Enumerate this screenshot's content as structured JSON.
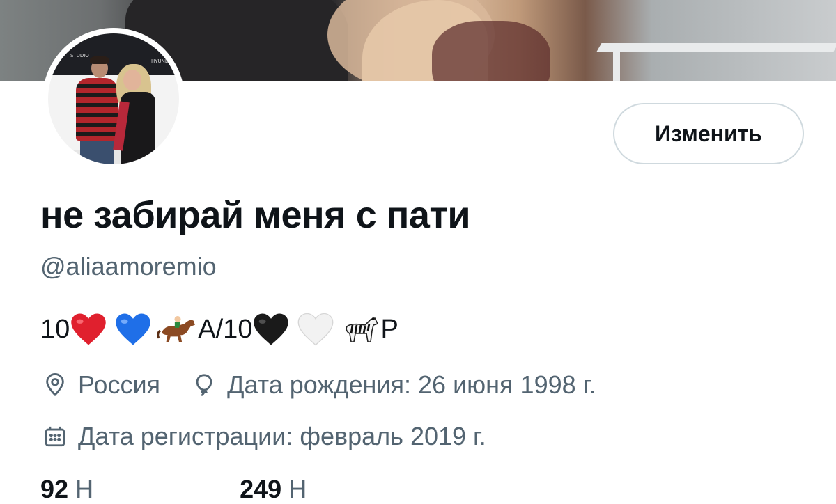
{
  "profile": {
    "display_name": "не забирай меня с пати",
    "handle": "@aliaamoremio",
    "bio_start": "10",
    "bio_mid": "А/10",
    "bio_end": "Р",
    "edit_button_label": "Изменить",
    "location": "Россия",
    "birthday": "Дата рождения: 26 июня 1998 г.",
    "joined": "Дата регистрации: февраль 2019 г."
  },
  "avatar_signs": {
    "left": "STUDIO",
    "right": "HYUNDAI"
  },
  "stats": {
    "following_count": "92",
    "following_label": "Н",
    "followers_count": "249",
    "followers_label": "Н"
  },
  "colors": {
    "text_primary": "#0f1419",
    "text_secondary": "#536471",
    "border": "#cfd9de"
  },
  "icons": [
    "location-pin-icon",
    "balloon-icon",
    "calendar-icon",
    "red-heart-emoji",
    "blue-heart-emoji",
    "horse-racing-emoji",
    "black-heart-emoji",
    "white-heart-emoji",
    "zebra-emoji"
  ]
}
